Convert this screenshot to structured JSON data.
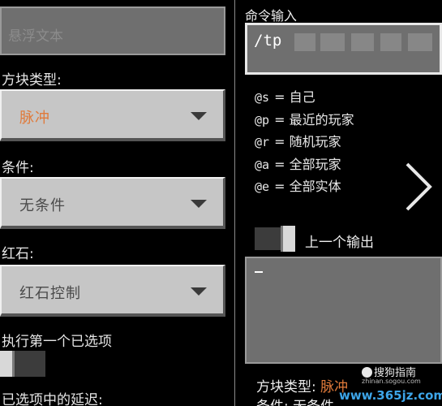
{
  "left_panel": {
    "hover_text_placeholder": "悬浮文本",
    "block_type_label": "方块类型:",
    "block_type_value": "脉冲",
    "condition_label": "条件:",
    "condition_value": "无条件",
    "redstone_label": "红石:",
    "redstone_value": "红石控制",
    "execute_first_label": "执行第一个已选项",
    "delay_label": "已选项中的延迟:"
  },
  "right_panel": {
    "command_input_label": "命令输入",
    "command_text": "/tp",
    "selectors": [
      {
        "code": "@s",
        "sep": "=",
        "desc": "自己"
      },
      {
        "code": "@p",
        "sep": "=",
        "desc": "最近的玩家"
      },
      {
        "code": "@r",
        "sep": "=",
        "desc": "随机玩家"
      },
      {
        "code": "@a",
        "sep": "=",
        "desc": "全部玩家"
      },
      {
        "code": "@e",
        "sep": "=",
        "desc": "全部实体"
      }
    ],
    "previous_output_label": "上一个输出",
    "output_text": "",
    "info_block_type_label": "方块类型:",
    "info_block_type_value": "脉冲",
    "info_condition_text": "条件: 无条件"
  },
  "watermark": {
    "sogou_text": "搜狗指南",
    "sogou_url": "zhinan.sogou.com",
    "site_text": "www.365jz.com"
  },
  "colors": {
    "accent_orange": "#e07a3a",
    "field_gray": "#6f6f6f",
    "button_gray": "#c6c6c6",
    "watermark_blue": "#3da5e8"
  },
  "icons": {
    "dropdown": "triangle-down",
    "next": "chevron-right",
    "sogou": "sogou-logo"
  }
}
